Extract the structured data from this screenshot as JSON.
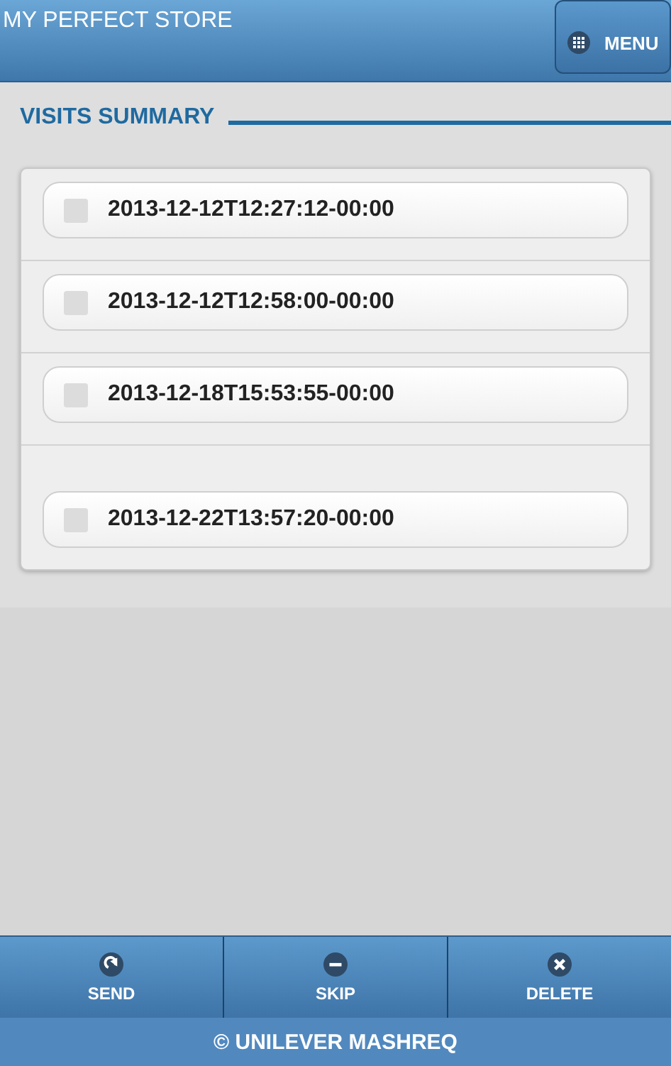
{
  "header": {
    "title": "MY PERFECT STORE",
    "menu_button": "MENU"
  },
  "section": {
    "title": "VISITS SUMMARY"
  },
  "visits": [
    {
      "label": "2013-12-12T12:27:12-00:00",
      "checked": false
    },
    {
      "label": "2013-12-12T12:58:00-00:00",
      "checked": false
    },
    {
      "label": "2013-12-18T15:53:55-00:00",
      "checked": false
    },
    {
      "label": "2013-12-22T13:57:20-00:00",
      "checked": false
    }
  ],
  "toolbar": [
    {
      "kind": "send",
      "label": "SEND"
    },
    {
      "kind": "skip",
      "label": "SKIP"
    },
    {
      "kind": "delete",
      "label": "DELETE"
    }
  ],
  "footer": "© UNILEVER MASHREQ"
}
